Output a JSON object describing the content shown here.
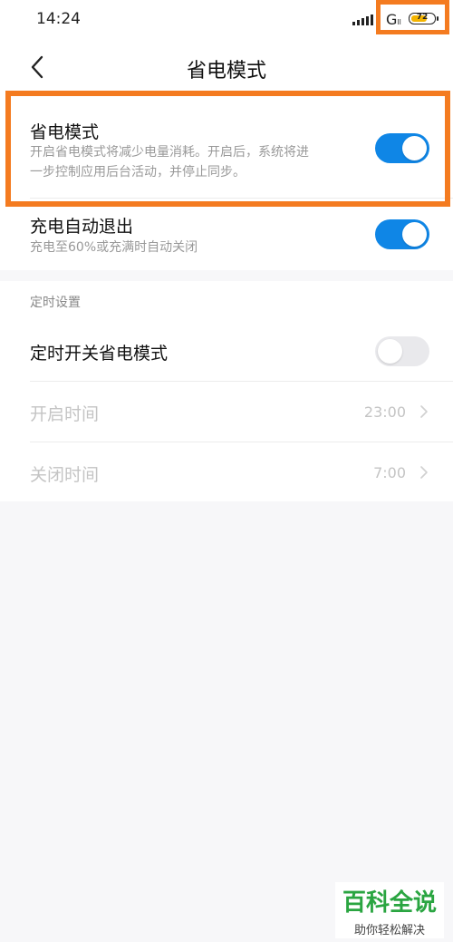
{
  "status_bar": {
    "time": "14:24",
    "network": "G",
    "network_sub": "ll",
    "battery_level": "72",
    "battery_fill_fraction": 0.72,
    "signal_icon": "signal-bars-icon",
    "battery_icon": "battery-icon"
  },
  "header": {
    "title": "省电模式",
    "back_icon": "chevron-left-icon"
  },
  "power_saving": {
    "title": "省电模式",
    "description_line1": "开启省电模式将减少电量消耗。开启后，系统将进",
    "description_line2": "一步控制应用后台活动，并停止同步。",
    "enabled": true
  },
  "auto_exit": {
    "title": "充电自动退出",
    "description": "充电至60%或充满时自动关闭",
    "enabled": true
  },
  "schedule": {
    "section_label": "定时设置",
    "toggle_title": "定时开关省电模式",
    "enabled": false,
    "start": {
      "label": "开启时间",
      "value": "23:00"
    },
    "end": {
      "label": "关闭时间",
      "value": "7:00"
    }
  },
  "watermark": {
    "title": "百科全说",
    "subtitle": "助你轻松解决"
  },
  "colors": {
    "accent": "#0f86e6",
    "highlight": "#f47b20",
    "watermark_green": "#2aa541"
  }
}
